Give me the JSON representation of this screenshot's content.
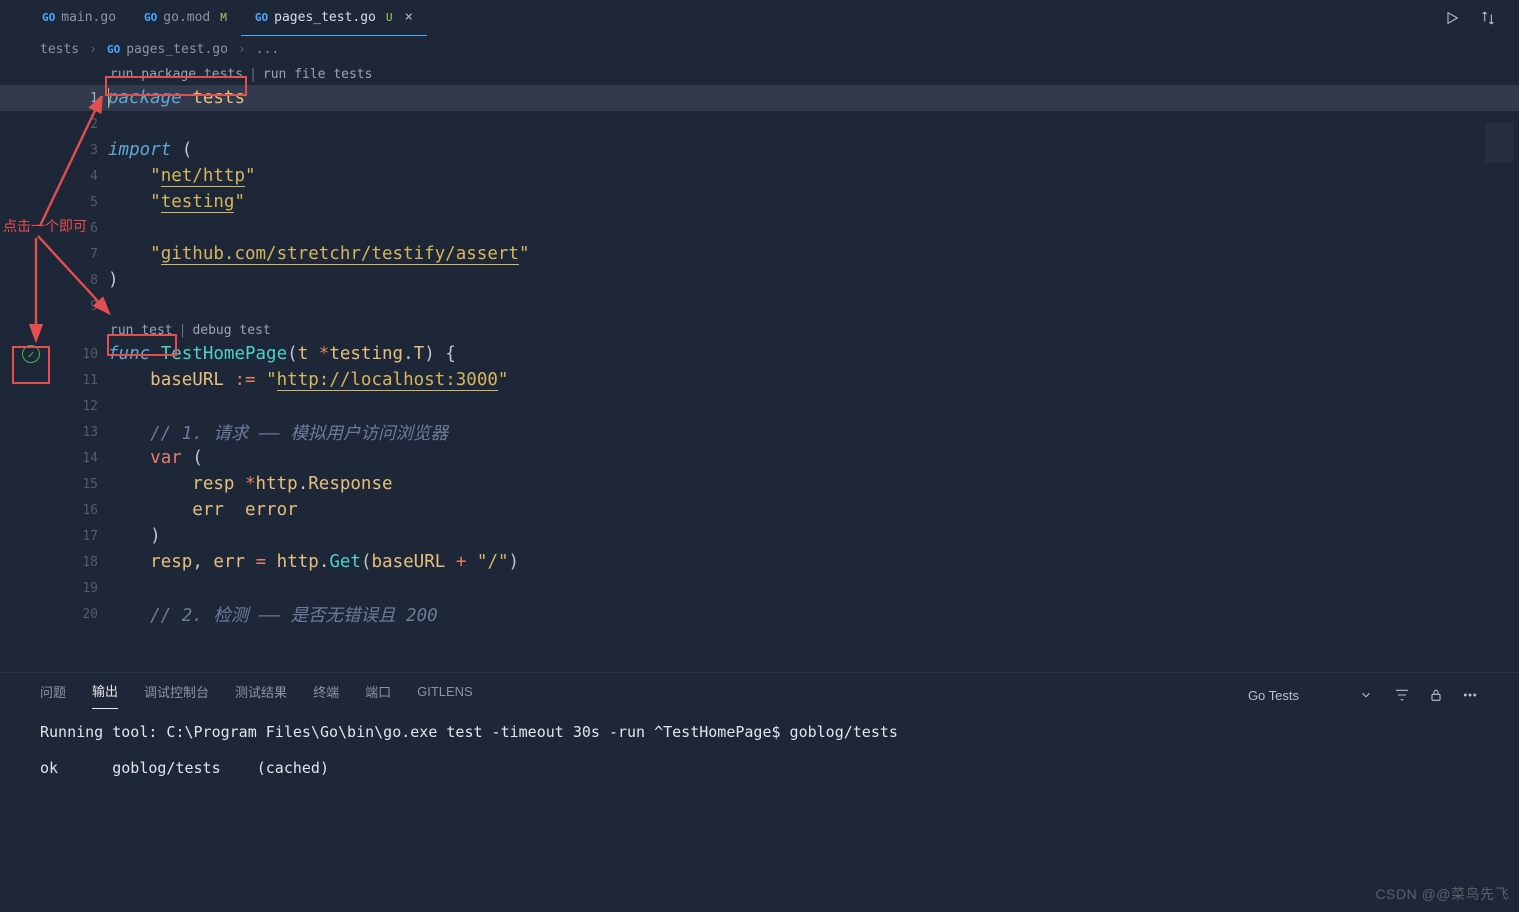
{
  "tabs": [
    {
      "icon": "GO",
      "label": "main.go",
      "flag": "",
      "active": false
    },
    {
      "icon": "GO",
      "label": "go.mod",
      "flag": "M",
      "active": false
    },
    {
      "icon": "GO",
      "label": "pages_test.go",
      "flag": "U",
      "active": true
    }
  ],
  "breadcrumbs": {
    "root": "tests",
    "file_icon": "GO",
    "file": "pages_test.go",
    "ellipsis": "..."
  },
  "codelens": {
    "pkg": {
      "run_pkg": "run package tests",
      "run_file": "run file tests"
    },
    "fn": {
      "run": "run test",
      "debug": "debug test"
    }
  },
  "code_lines": [
    {
      "n": 1,
      "type": "pkg-decl",
      "kw": "package",
      "name": "tests",
      "current": true
    },
    {
      "n": 2,
      "type": "blank"
    },
    {
      "n": 3,
      "type": "import-open",
      "kw": "import",
      "paren": "("
    },
    {
      "n": 4,
      "type": "import",
      "value": "net/http"
    },
    {
      "n": 5,
      "type": "import",
      "value": "testing"
    },
    {
      "n": 6,
      "type": "blank-import"
    },
    {
      "n": 7,
      "type": "import",
      "value": "github.com/stretchr/testify/assert"
    },
    {
      "n": 8,
      "type": "import-close",
      "paren": ")"
    },
    {
      "n": 9,
      "type": "blank"
    }
  ],
  "func_lines": [
    {
      "n": 10,
      "html": "func",
      "name": "TestHomePage",
      "params": "(t *testing.T) {"
    },
    {
      "n": 11,
      "raw": "    baseURL := \"http://localhost:3000\""
    },
    {
      "n": 12,
      "raw": ""
    },
    {
      "n": 13,
      "comment": "    // 1. 请求 —— 模拟用户访问浏览器"
    },
    {
      "n": 14,
      "raw": "    var ("
    },
    {
      "n": 15,
      "raw": "        resp *http.Response"
    },
    {
      "n": 16,
      "raw": "        err  error"
    },
    {
      "n": 17,
      "raw": "    )"
    },
    {
      "n": 18,
      "raw": "    resp, err = http.Get(baseURL + \"/\")"
    },
    {
      "n": 19,
      "raw": ""
    },
    {
      "n": 20,
      "comment": "    // 2. 检测 —— 是否无错误且 200"
    }
  ],
  "annotations": {
    "click_hint": "点击一个即可"
  },
  "panel": {
    "tabs": [
      "问题",
      "输出",
      "调试控制台",
      "测试结果",
      "终端",
      "端口",
      "GITLENS"
    ],
    "active": 1,
    "dropdown": "Go Tests",
    "terminal": {
      "line1": "Running tool: C:\\Program Files\\Go\\bin\\go.exe test -timeout 30s -run ^TestHomePage$ goblog/tests",
      "line2": "",
      "line3": "ok      goblog/tests    (cached)"
    }
  },
  "watermark": "CSDN @@菜鸟先飞"
}
